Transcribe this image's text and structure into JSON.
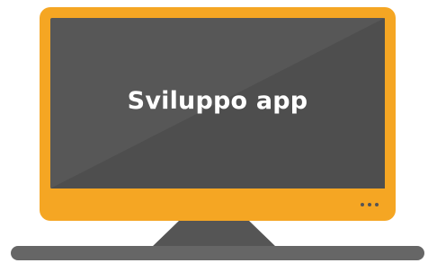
{
  "screen": {
    "title": "Sviluppo app"
  },
  "icons": {
    "monitor": "monitor-icon",
    "dots": "more-dots-icon"
  },
  "colors": {
    "bezel": "#F5A623",
    "screen_dark": "#4f4f4f",
    "screen_light": "#5a5a5a",
    "stand": "#555555",
    "base": "#666666"
  }
}
